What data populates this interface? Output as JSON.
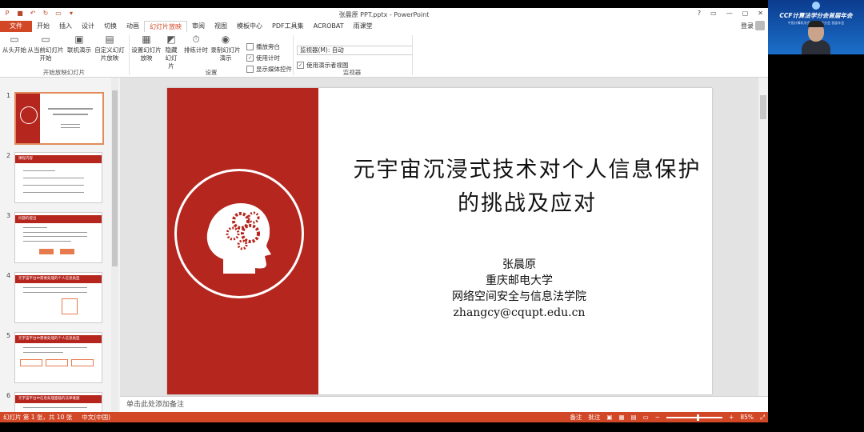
{
  "window": {
    "title": "张晨原 PPT.pptx - PowerPoint",
    "controls": [
      "?",
      "▭",
      "—",
      "▢",
      "✕"
    ]
  },
  "tabs": [
    "文件",
    "开始",
    "插入",
    "设计",
    "切换",
    "动画",
    "幻灯片放映",
    "审阅",
    "视图",
    "模板中心",
    "PDF工具集",
    "ACROBAT",
    "雨课堂"
  ],
  "active_tab": "幻灯片放映",
  "login_label": "登录",
  "ribbon": {
    "start_group": {
      "label": "开始放映幻灯片",
      "buttons": [
        "从头开始",
        "从当前幻灯片开始",
        "联机演示",
        "自定义幻灯片放映"
      ]
    },
    "setup_group": {
      "label": "设置",
      "buttons": [
        "设置幻灯片放映",
        "隐藏幻灯片",
        "排练计时",
        "录制幻灯片演示"
      ],
      "checks": [
        {
          "label": "播放旁白",
          "checked": false
        },
        {
          "label": "使用计时",
          "checked": true
        },
        {
          "label": "显示媒体控件",
          "checked": false
        }
      ]
    },
    "monitor_group": {
      "label": "监视器",
      "monitor_select": "监视器(M): 自动",
      "presenter_view": {
        "label": "使用演示者视图",
        "checked": true
      }
    }
  },
  "thumbnails": [
    {
      "num": "1",
      "header": "",
      "lines": 0,
      "selected": true
    },
    {
      "num": "2",
      "header": "课程内容",
      "lines": 4
    },
    {
      "num": "3",
      "header": "问题的提出",
      "lines": 4
    },
    {
      "num": "4",
      "header": "元宇宙平台中需要处理的个人信息类型",
      "lines": 3
    },
    {
      "num": "5",
      "header": "元宇宙平台中需要处理的个人信息类型",
      "lines": 3
    },
    {
      "num": "6",
      "header": "元宇宙平台中信息处理面临的法律难题",
      "lines": 2
    }
  ],
  "slide": {
    "title": "元宇宙沉浸式技术对个人信息保护的挑战及应对",
    "author": "张晨原",
    "affiliation": "重庆邮电大学",
    "school": "网络空间安全与信息法学院",
    "email": "zhangcy@cqupt.edu.cn",
    "accent_color": "#b5261e"
  },
  "notes_placeholder": "单击此处添加备注",
  "status": {
    "slide_info": "幻灯片 第 1 张，共 10 张",
    "language": "中文(中国)",
    "notes_btn": "备注",
    "comments_btn": "批注",
    "zoom": "85%"
  },
  "side_panel": {
    "banner_title": "CCF计算法学分会首届年会",
    "banner_sub": "中国计算机学会 计算法学分会 首届年会",
    "banner_color": "#1b6fc9"
  }
}
